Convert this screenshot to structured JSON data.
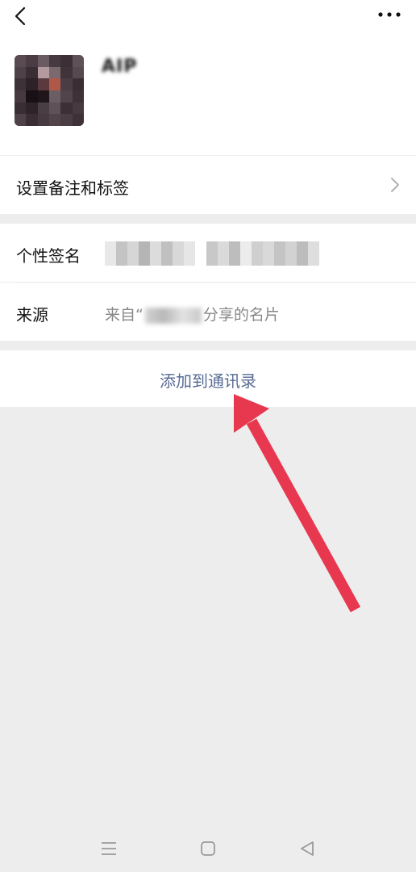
{
  "profile": {
    "name": "AIP"
  },
  "rows": {
    "remark_label": "设置备注和标签",
    "signature_label": "个性签名",
    "source_label": "来源",
    "source_prefix": "来自“",
    "source_suffix": "分享的名片"
  },
  "actions": {
    "add_contact": "添加到通讯录"
  },
  "icons": {
    "back": "chevron-left-icon",
    "more": "more-dots-icon",
    "chevron": "chevron-right-icon",
    "nav_menu": "menu-icon",
    "nav_home": "home-square-icon",
    "nav_back": "triangle-back-icon"
  },
  "colors": {
    "link": "#576b95",
    "arrow": "#e8384f",
    "background": "#ededed"
  }
}
